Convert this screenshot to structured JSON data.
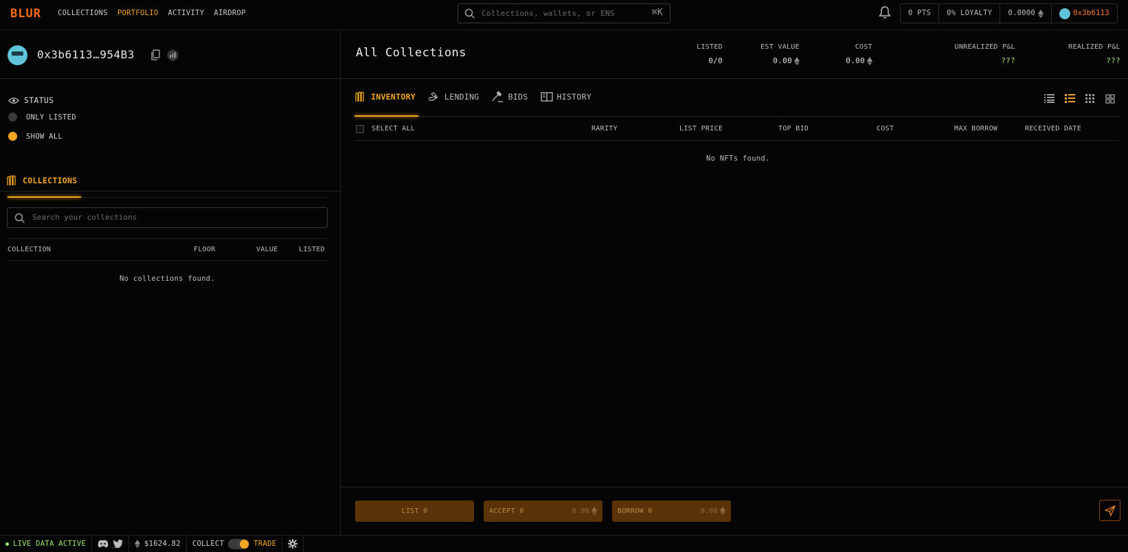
{
  "brand": {
    "logo": "BLUR"
  },
  "nav": {
    "collections": "COLLECTIONS",
    "portfolio": "PORTFOLIO",
    "activity": "ACTIVITY",
    "airdrop": "AIRDROP"
  },
  "search": {
    "placeholder": "Collections, wallets, or ENS",
    "shortcut": "⌘K"
  },
  "header_pills": {
    "points": "0 PTS",
    "loyalty": "0% LOYALTY",
    "balance": "0.0000",
    "wallet": "0x3b6113"
  },
  "profile": {
    "address": "0x3b6113…954B3"
  },
  "status": {
    "title": "STATUS",
    "options": [
      {
        "label": "ONLY LISTED",
        "selected": false
      },
      {
        "label": "SHOW ALL",
        "selected": true
      }
    ]
  },
  "collections_panel": {
    "tab": "COLLECTIONS",
    "search_placeholder": "Search your collections",
    "columns": {
      "collection": "COLLECTION",
      "floor": "FLOOR",
      "value": "VALUE",
      "listed": "LISTED"
    },
    "empty": "No collections found."
  },
  "summary": {
    "title": "All Collections",
    "stats": {
      "listed": {
        "label": "LISTED",
        "value": "0/0"
      },
      "est_value": {
        "label": "EST VALUE",
        "value": "0.00"
      },
      "cost": {
        "label": "COST",
        "value": "0.00"
      },
      "unrealized": {
        "label": "UNREALIZED P&L",
        "value": "???"
      },
      "realized": {
        "label": "REALIZED P&L",
        "value": "???"
      }
    }
  },
  "tabs": {
    "inventory": "INVENTORY",
    "lending": "LENDING",
    "bids": "BIDS",
    "history": "HISTORY"
  },
  "nft_table": {
    "columns": {
      "select_all": "SELECT ALL",
      "rarity": "RARITY",
      "list_price": "LIST PRICE",
      "top_bid": "TOP BID",
      "cost": "COST",
      "max_borrow": "MAX BORROW",
      "received_date": "RECEIVED DATE"
    },
    "empty": "No NFTs found."
  },
  "actions": {
    "list": "LIST 0",
    "accept": "ACCEPT 0",
    "accept_amount": "0.00",
    "borrow": "BORROW 0",
    "borrow_amount": "0.00"
  },
  "footer": {
    "live": "LIVE DATA ACTIVE",
    "eth_price": "$1624.82",
    "collect": "COLLECT",
    "trade": "TRADE"
  },
  "colors": {
    "accent": "#f5a623",
    "logo": "#ff6b17",
    "positive": "#9ae86b",
    "background": "#050505"
  }
}
